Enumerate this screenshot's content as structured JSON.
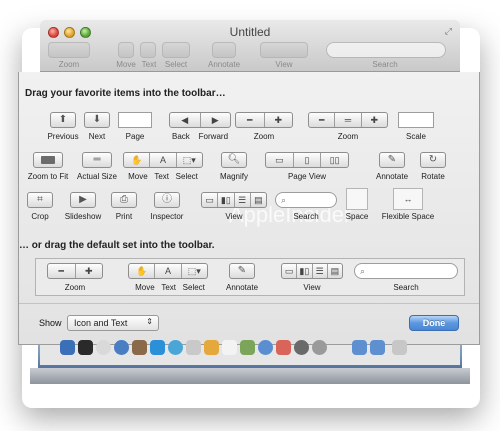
{
  "window": {
    "title": "Untitled",
    "background_toolbar_labels": [
      "Zoom",
      "Move",
      "Text",
      "Select",
      "Annotate",
      "View",
      "Search"
    ]
  },
  "sheet": {
    "heading_palette": "Drag your favorite items into the toolbar…",
    "heading_default": "… or drag the default set into the toolbar.",
    "palette_items": {
      "previous": "Previous",
      "next": "Next",
      "page": "Page",
      "back": "Back",
      "forward": "Forward",
      "zoom": "Zoom",
      "zoom2": "Zoom",
      "scale": "Scale",
      "zoom_to_fit": "Zoom to Fit",
      "actual_size": "Actual Size",
      "move": "Move",
      "text": "Text",
      "select": "Select",
      "magnify": "Magnify",
      "page_view": "Page View",
      "annotate": "Annotate",
      "rotate": "Rotate",
      "crop": "Crop",
      "slideshow": "Slideshow",
      "print": "Print",
      "inspector": "Inspector",
      "view": "View",
      "search": "Search",
      "space": "Space",
      "flexible_space": "Flexible Space"
    },
    "default_set": {
      "zoom": "Zoom",
      "move": "Move",
      "text": "Text",
      "select": "Select",
      "annotate": "Annotate",
      "view": "View",
      "search": "Search"
    },
    "show_label": "Show",
    "show_value": "Icon and Text",
    "done_label": "Done"
  },
  "watermark": "AppleInsider",
  "colors": {
    "accent": "#4b86d4",
    "dock": "#6f8fb6"
  }
}
